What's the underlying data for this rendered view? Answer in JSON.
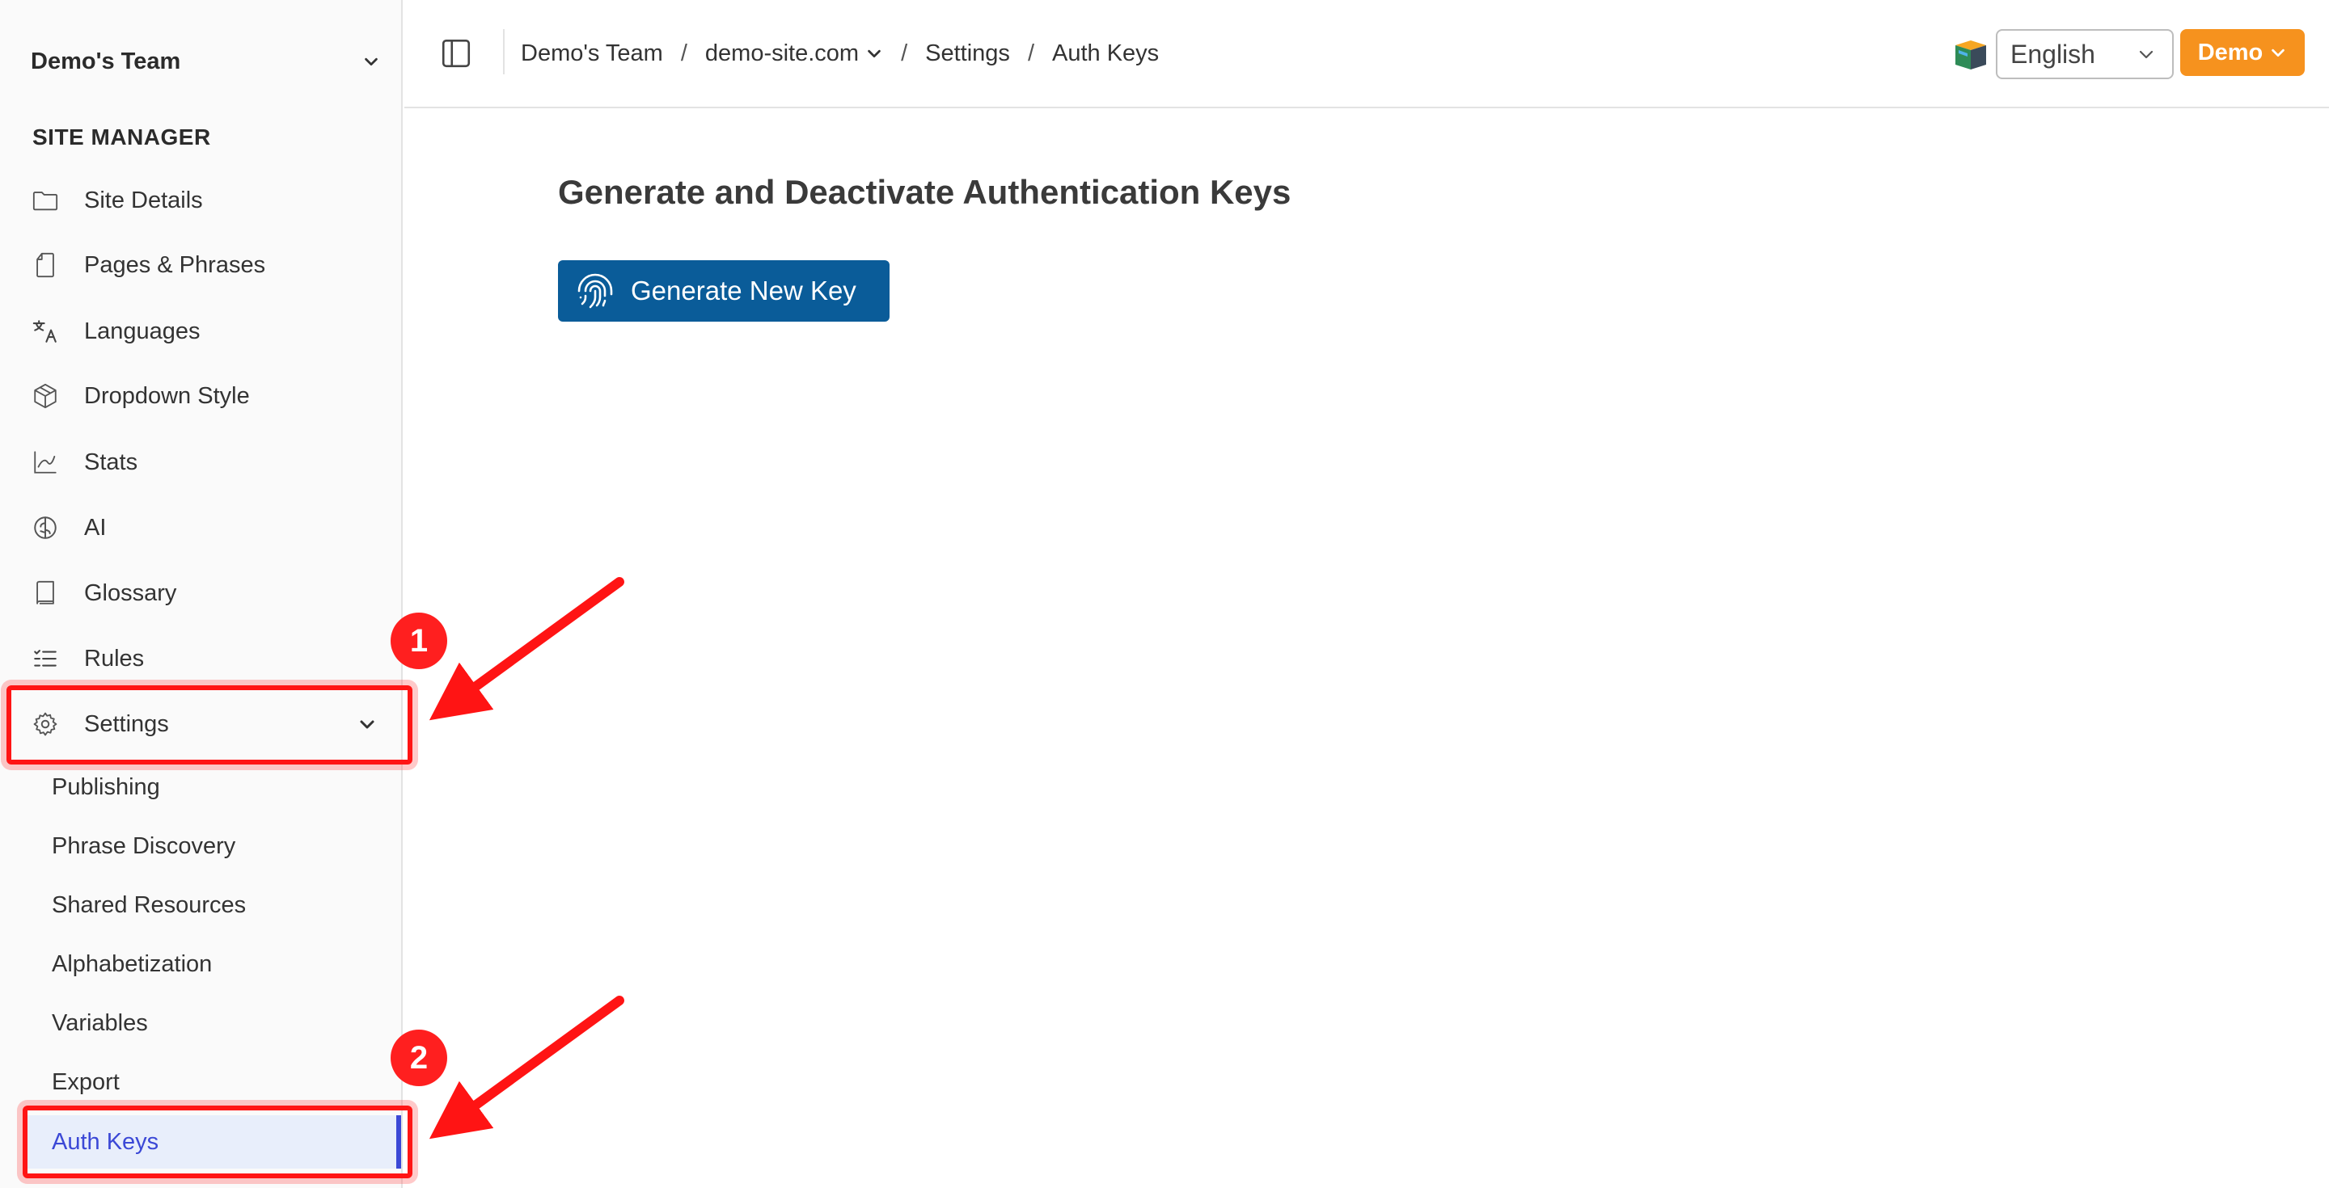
{
  "sidebar": {
    "team_name": "Demo's Team",
    "section_title": "SITE MANAGER",
    "items": [
      {
        "label": "Site Details",
        "icon": "folder-icon"
      },
      {
        "label": "Pages & Phrases",
        "icon": "file-icon"
      },
      {
        "label": "Languages",
        "icon": "translate-icon"
      },
      {
        "label": "Dropdown Style",
        "icon": "package-icon"
      },
      {
        "label": "Stats",
        "icon": "line-chart-icon"
      },
      {
        "label": "AI",
        "icon": "brain-icon"
      },
      {
        "label": "Glossary",
        "icon": "book-icon"
      },
      {
        "label": "Rules",
        "icon": "list-checks-icon"
      },
      {
        "label": "Settings",
        "icon": "gear-icon"
      }
    ],
    "settings_sub": [
      {
        "label": "Publishing"
      },
      {
        "label": "Phrase Discovery"
      },
      {
        "label": "Shared Resources"
      },
      {
        "label": "Alphabetization"
      },
      {
        "label": "Variables"
      },
      {
        "label": "Export"
      },
      {
        "label": "Auth Keys",
        "active": true
      }
    ]
  },
  "header": {
    "breadcrumb": [
      "Demo's Team",
      "demo-site.com",
      "Settings",
      "Auth Keys"
    ],
    "separator": "/",
    "language": "English",
    "user_button": "Demo"
  },
  "main": {
    "title": "Generate and Deactivate Authentication Keys",
    "generate_button": "Generate New Key"
  },
  "annotations": {
    "step1": "1",
    "step2": "2",
    "color": "#ff1414"
  },
  "colors": {
    "accent": "#3b48d6",
    "primary_button": "#0a5c99",
    "user_button": "#f6921e"
  }
}
